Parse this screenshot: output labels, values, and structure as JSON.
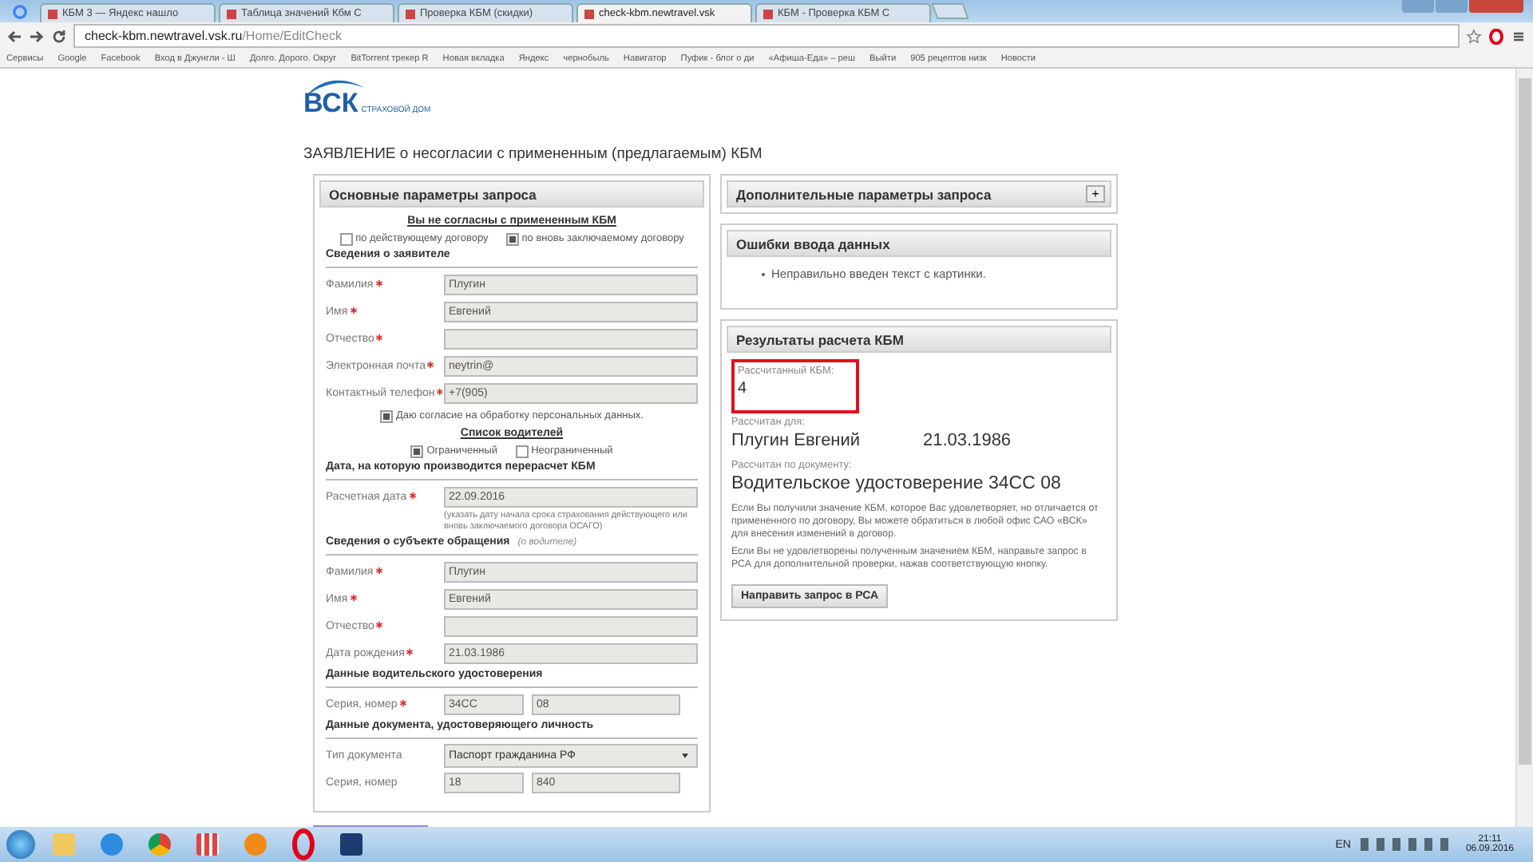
{
  "browser": {
    "tabs": [
      {
        "label": "КБМ 3 — Яндекс нашло",
        "selected": false
      },
      {
        "label": "Таблица значений Кбм С",
        "selected": false
      },
      {
        "label": "Проверка КБМ (скидки)",
        "selected": false
      },
      {
        "label": "check-kbm.newtravel.vsk",
        "selected": true
      },
      {
        "label": "КБМ - Проверка КБМ С",
        "selected": false
      }
    ],
    "address": {
      "host": "check-kbm.newtravel.vsk.ru",
      "path": "/Home/EditCheck"
    },
    "bookmarks": [
      "Сервисы",
      "Google",
      "Facebook",
      "Вход в Джунгли - Ш",
      "Долго. Дорого. Округ",
      "BitTorrent трекер R",
      "Новая вкладка",
      "Яндекс",
      "чернобыль",
      "Навигатор",
      "Пуфик - блог о ди",
      "«Афиша-Еда» – реш",
      "Выйти",
      "905 рецептов низк",
      "Новости"
    ]
  },
  "logo": {
    "mark": "ВСК",
    "tagline": "СТРАХОВОЙ ДОМ"
  },
  "title": "ЗАЯВЛЕНИЕ о несогласии с примененным (предлагаемым) КБМ",
  "main_panel": {
    "title": "Основные параметры запроса",
    "rows": [
      {
        "kind": "heading",
        "text": "Вы не согласны с примененным КБМ"
      },
      {
        "kind": "checks",
        "items": [
          {
            "label": "по действующему договору",
            "checked": false
          },
          {
            "label": "по вновь заключаемому договору",
            "checked": true
          }
        ]
      },
      {
        "kind": "section",
        "text": "Сведения о заявителе"
      },
      {
        "kind": "field",
        "label": "Фамилия",
        "required": true,
        "values": [
          "Плугин"
        ]
      },
      {
        "kind": "field",
        "label": "Имя",
        "required": true,
        "values": [
          "Евгений"
        ]
      },
      {
        "kind": "field",
        "label": "Отчество",
        "required": true
      },
      {
        "kind": "field",
        "label": "Электронная почта",
        "required": true,
        "values": [
          "neytrin@"
        ]
      },
      {
        "kind": "field",
        "label": "Контактный телефон",
        "required": true,
        "values": [
          "+7(905)"
        ]
      },
      {
        "kind": "consent",
        "label": "Даю согласие на обработку персональных данных.",
        "checked": true
      },
      {
        "kind": "heading",
        "text": "Список водителей"
      },
      {
        "kind": "checks",
        "items": [
          {
            "label": "Ограниченный",
            "checked": true
          },
          {
            "label": "Неограниченный",
            "checked": false
          }
        ]
      },
      {
        "kind": "section",
        "text": "Дата, на которую производится перерасчет КБМ"
      },
      {
        "kind": "field",
        "label": "Расчетная дата",
        "required": true,
        "values": [
          "22.09.2016"
        ]
      },
      {
        "kind": "hint",
        "text": "(указать дату начала срока страхования действующего или вновь заключаемого договора ОСАГО)"
      },
      {
        "kind": "section",
        "text": "Сведения о субъекте обращения",
        "note": "(о водителе)"
      },
      {
        "kind": "field",
        "label": "Фамилия",
        "required": true,
        "values": [
          "Плугин"
        ]
      },
      {
        "kind": "field",
        "label": "Имя",
        "required": true,
        "values": [
          "Евгений"
        ]
      },
      {
        "kind": "field",
        "label": "Отчество",
        "required": true
      },
      {
        "kind": "field",
        "label": "Дата рождения",
        "required": true,
        "values": [
          "21.03.1986"
        ]
      },
      {
        "kind": "section",
        "text": "Данные водительского удостоверения"
      },
      {
        "kind": "field",
        "label": "Серия, номер",
        "required": true,
        "values": [
          "34CC",
          "08"
        ]
      },
      {
        "kind": "section",
        "text": "Данные документа, удостоверяющего личность"
      },
      {
        "kind": "select",
        "label": "Тип документа",
        "value": "Паспорт гражданина РФ"
      },
      {
        "kind": "field",
        "label": "Серия, номер",
        "required": false,
        "values": [
          "18",
          "840"
        ]
      }
    ]
  },
  "extra_panel": {
    "title": "Дополнительные параметры запроса",
    "expand_label": "+"
  },
  "errors_panel": {
    "title": "Ошибки ввода данных",
    "items": [
      "Неправильно введен текст с картинки."
    ]
  },
  "results_panel": {
    "title": "Результаты расчета КБМ",
    "kbm_label": "Рассчитанный КБМ:",
    "kbm_value": "4",
    "highlighted": true,
    "for_label": "Рассчитан для:",
    "person": "Плугин Евгений",
    "birth_date": "21.03.1986",
    "doc_label": "Рассчитан по документу:",
    "document": "Водительское удостоверение 34CC 08",
    "notes": [
      "Если Вы получили значение КБМ, которое Вас удовлетворяет, но отличается от примененного по договору, Вы можете обратиться в любой офис САО «ВСК» для внесения изменений в договор.",
      "Если Вы не удовлетворены полученным значением КБМ, направьте запрос в РСА для дополнительной проверки, нажав соответствующую кнопку."
    ],
    "button": "Направить запрос в РСА"
  },
  "taskbar": {
    "language": "EN",
    "time": "21:11",
    "date": "06.09.2016"
  }
}
